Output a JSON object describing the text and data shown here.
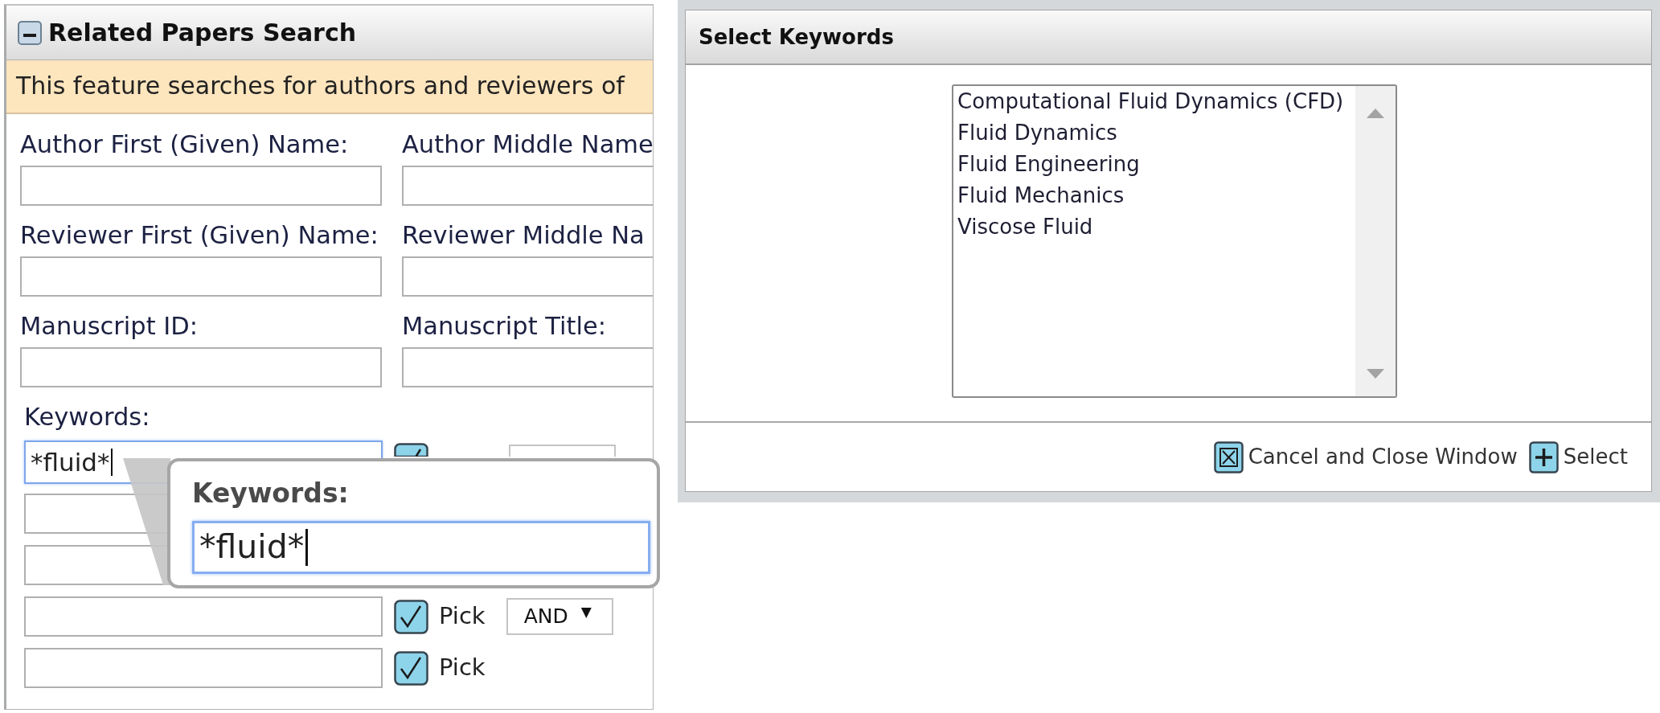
{
  "panel": {
    "title": "Related Papers Search",
    "expanded": true,
    "notice": "This feature searches for authors and reviewers of",
    "fields": [
      {
        "label": "Author First (Given) Name:"
      },
      {
        "label": "Author Middle Name"
      },
      {
        "label": "Reviewer First (Given) Name:"
      },
      {
        "label": "Reviewer Middle Na"
      },
      {
        "label": "Manuscript ID:"
      },
      {
        "label": "Manuscript Title:"
      }
    ],
    "keywords": {
      "label": "Keywords:",
      "rows": [
        {
          "value": "*fluid*",
          "focused": true,
          "kind": "covered"
        },
        {
          "focused": false,
          "kind": "plain"
        },
        {
          "focused": false,
          "kind": "plain"
        },
        {
          "focused": false,
          "kind": "full",
          "pick": "Pick",
          "operator": {
            "value": "AND",
            "arrow": "▼"
          }
        },
        {
          "focused": false,
          "kind": "pick",
          "pick": "Pick"
        }
      ]
    }
  },
  "callout": {
    "label": "Keywords:",
    "value": "*fluid*",
    "focused": true
  },
  "dialog": {
    "title": "Select Keywords",
    "options": [
      {
        "label": "Computational Fluid Dynamics (CFD)",
        "selected": false
      },
      {
        "label": "Fluid Dynamics",
        "selected": false
      },
      {
        "label": "Fluid Engineering",
        "selected": false
      },
      {
        "label": "Fluid Mechanics",
        "selected": false
      },
      {
        "label": "Viscose Fluid",
        "selected": false
      }
    ],
    "buttons": [
      {
        "kind": "cancel",
        "label": "Cancel and Close Window"
      },
      {
        "kind": "add",
        "label": "Select"
      }
    ]
  }
}
